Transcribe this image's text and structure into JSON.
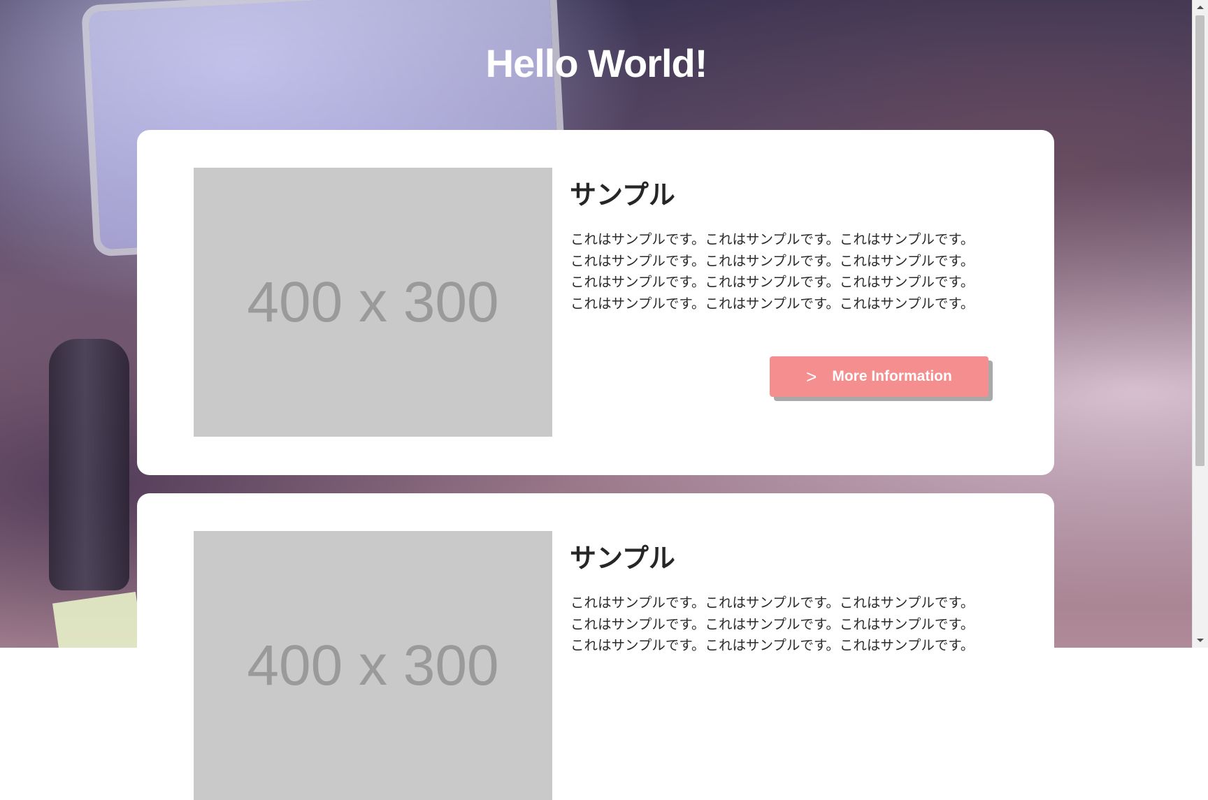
{
  "header": {
    "title": "Hello World!"
  },
  "cards": [
    {
      "image_placeholder": "400 x 300",
      "title": "サンプル",
      "lines": [
        "これはサンプルです。これはサンプルです。これはサンプルです。",
        "これはサンプルです。これはサンプルです。これはサンプルです。",
        "これはサンプルです。これはサンプルです。これはサンプルです。",
        "これはサンプルです。これはサンプルです。これはサンプルです。"
      ],
      "button": {
        "label": "More Information",
        "icon": "chevron-right-icon",
        "color": "#f58f8f"
      }
    },
    {
      "image_placeholder": "400 x 300",
      "title": "サンプル",
      "lines": [
        "これはサンプルです。これはサンプルです。これはサンプルです。",
        "これはサンプルです。これはサンプルです。これはサンプルです。",
        "これはサンプルです。これはサンプルです。これはサンプルです。"
      ]
    }
  ],
  "colors": {
    "card_background": "#ffffff",
    "image_placeholder": "#c9c9c9",
    "accent": "#f58f8f"
  }
}
